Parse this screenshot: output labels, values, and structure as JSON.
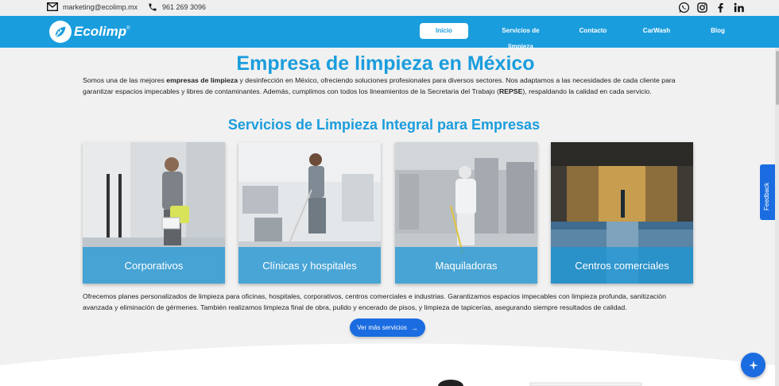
{
  "topbar": {
    "email": "marketing@ecolimp.mx",
    "phone": "961 269 3096",
    "social_icons": [
      "whatsapp-icon",
      "instagram-icon",
      "facebook-icon",
      "linkedin-icon"
    ]
  },
  "nav": {
    "brand": "Ecolimp",
    "brand_mark": "®",
    "items": [
      {
        "label": "Inicio",
        "active": true
      },
      {
        "label": "Servicios de limpieza",
        "active": false
      },
      {
        "label": "Contacto",
        "active": false
      },
      {
        "label": "CarWash",
        "active": false
      },
      {
        "label": "Blog",
        "active": false
      }
    ]
  },
  "main": {
    "title": "Empresa de limpieza en México",
    "intro": {
      "p1": "Somos una de las mejores ",
      "b1": "empresas de limpieza",
      "p2": " y desinfección en México, ofreciendo soluciones profesionales para diversos sectores. Nos adaptamos a las necesidades de cada cliente para garantizar espacios impecables y libres de contaminantes. Además, cumplimos con todos los lineamientos de la Secretaria del Trabajo (",
      "b2": "REPSE",
      "p3": "), respaldando la calidad en cada servicio."
    },
    "subtitle": "Servicios de Limpieza Integral para Empresas",
    "cards": [
      {
        "label": "Corporativos"
      },
      {
        "label": "Clínicas y hospitales"
      },
      {
        "label": "Maquiladoras"
      },
      {
        "label": "Centros comerciales"
      }
    ],
    "description": "Ofrecemos planes personalizados de limpieza para oficinas, hospitales, corporativos, centros comerciales e industrias. Garantizamos espacios impecables con limpieza profunda, sanitización avanzada y eliminación de gérmenes. También realizamos limpieza final de obra, pulido y encerado de pisos, y limpieza de tapicerías, asegurando siempre resultados de calidad.",
    "cta_label": "Ver más servicios",
    "cta_arrow": "→"
  },
  "widgets": {
    "feedback_label": "Feedback",
    "fab_icon": "sparkle-icon"
  },
  "colors": {
    "brand_blue": "#1a9ddd",
    "button_blue": "#1a6ce0",
    "background": "#f1f1f1"
  }
}
